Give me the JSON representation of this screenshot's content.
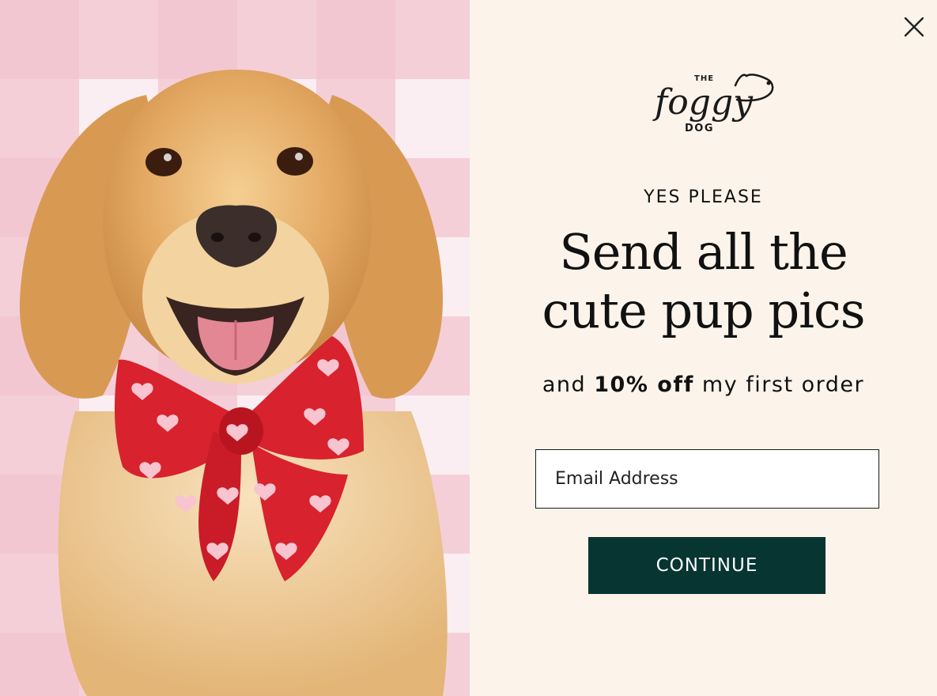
{
  "brand": {
    "logo_text_top": "THE",
    "logo_text_main": "foggy",
    "logo_text_bottom": "DOG"
  },
  "popup": {
    "eyebrow": "YES PLEASE",
    "headline_line1": "Send all the",
    "headline_line2": "cute pup pics",
    "subline_pre": "and ",
    "subline_bold": "10% off",
    "subline_post": " my first order",
    "email_placeholder": "Email Address",
    "email_value": "",
    "continue_label": "CONTINUE"
  },
  "colors": {
    "panel_background": "#fcf4ea",
    "button_background": "#063532",
    "button_text": "#ffffff",
    "text": "#111111",
    "gingham_pink": "#f3c4cf",
    "bow_red": "#d8222e"
  },
  "icons": {
    "close": "close-icon",
    "logo": "foggy-dog-logo"
  }
}
